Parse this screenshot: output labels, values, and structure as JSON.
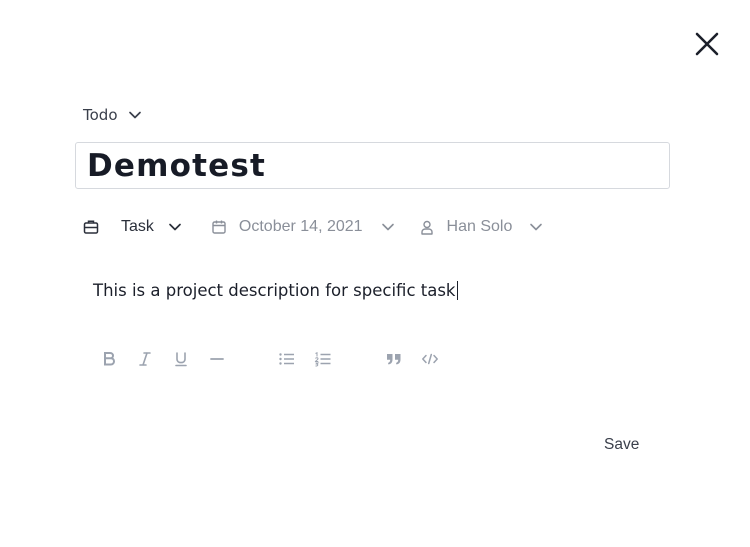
{
  "close_icon": "close-icon",
  "status": {
    "label": "Todo",
    "icon": "chevron-down-icon"
  },
  "title": "Demotest",
  "meta": {
    "type": {
      "icon": "briefcase-icon",
      "label": "Task"
    },
    "date": {
      "icon": "calendar-icon",
      "label": "October 14, 2021"
    },
    "assignee": {
      "icon": "user-icon",
      "label": "Han Solo"
    }
  },
  "description": "This is a project description for specific task",
  "toolbar": [
    "bold-icon",
    "italic-icon",
    "underline-icon",
    "horizontal-rule-icon",
    "bullet-list-icon",
    "numbered-list-icon",
    "quote-icon",
    "code-icon"
  ],
  "save_label": "Save",
  "colors": {
    "text": "#1f2330",
    "muted": "#8a8f99",
    "icon": "#9ca3af",
    "border": "#d6d9de"
  }
}
